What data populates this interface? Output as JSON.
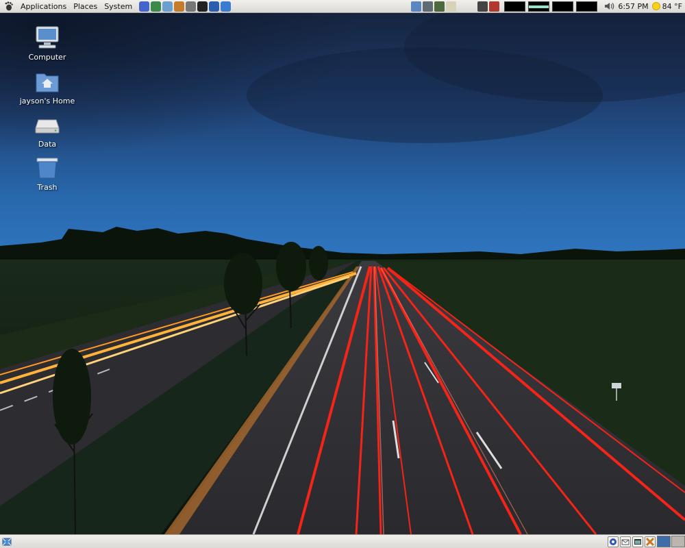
{
  "top_panel": {
    "menus": [
      "Applications",
      "Places",
      "System"
    ],
    "clock": "6:57 PM",
    "weather": "84 °F"
  },
  "launchers": [
    {
      "icon": "help-icon",
      "color": "#4466cc"
    },
    {
      "icon": "web-browser-globe-icon",
      "color": "#3a8a4a"
    },
    {
      "icon": "email-client-icon",
      "color": "#6a9fd0"
    },
    {
      "icon": "office-cross-icon",
      "color": "#c47c2c"
    },
    {
      "icon": "inkscape-pen-icon",
      "color": "#777777"
    },
    {
      "icon": "terminal-icon",
      "color": "#222222"
    },
    {
      "icon": "skype-icon",
      "color": "#2a5fb0"
    },
    {
      "icon": "instant-messenger-icon",
      "color": "#3b7bd0"
    }
  ],
  "applets": [
    {
      "icon": "file-manager-icon",
      "color": "#5b86c2"
    },
    {
      "icon": "monitor-icon",
      "color": "#5f6a72"
    },
    {
      "icon": "calculator-icon",
      "color": "#4c6a3e"
    },
    {
      "icon": "text-editor-icon",
      "color": "#d8d2b8"
    },
    {
      "icon": "lock-screen-icon",
      "color": "#444444"
    },
    {
      "icon": "logout-icon",
      "color": "#b03a2e"
    }
  ],
  "system_monitors": [
    "cpu",
    "memory",
    "network",
    "load"
  ],
  "desktop_icons": [
    {
      "label": "Computer",
      "icon": "computer-icon"
    },
    {
      "label": "jayson's Home",
      "icon": "home-folder-icon"
    },
    {
      "label": "Data",
      "icon": "drive-icon"
    },
    {
      "label": "Trash",
      "icon": "trash-icon"
    }
  ],
  "bottom_panel": {
    "tray": [
      "tray-app-icon",
      "tray-mail-icon",
      "tray-window-icon",
      "tray-office-icon"
    ],
    "workspaces": 2,
    "active_workspace": 1
  },
  "colors": {
    "panel": "#dcdad5",
    "sky_top": "#1c2f55",
    "sky_bottom": "#2a6bb0",
    "tail_lights": "#ff2a1a",
    "head_lights": "#ffb63a"
  }
}
